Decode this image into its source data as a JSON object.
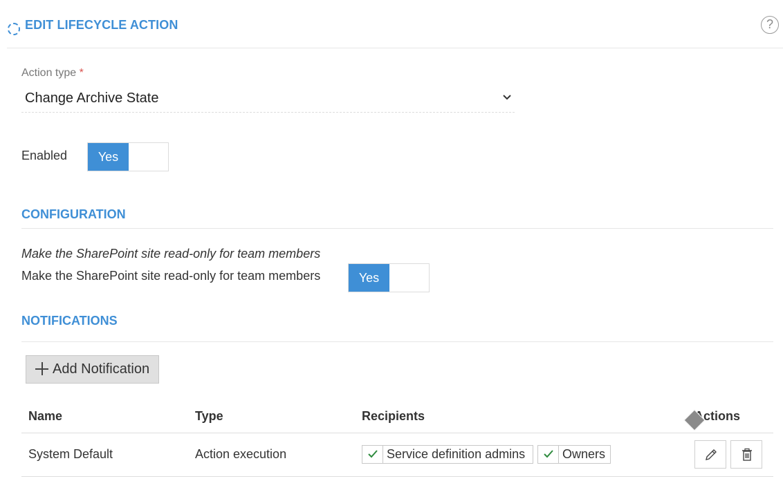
{
  "header": {
    "title": "EDIT LIFECYCLE ACTION",
    "help_glyph": "?"
  },
  "action_type": {
    "label": "Action type",
    "required_marker": "*",
    "selected_value": "Change Archive State"
  },
  "enabled": {
    "label": "Enabled",
    "toggle_value": "Yes"
  },
  "configuration": {
    "section_title": "CONFIGURATION",
    "description": "Make the SharePoint site read-only for team members",
    "field_label": "Make the SharePoint site read-only for team members",
    "toggle_value": "Yes"
  },
  "notifications": {
    "section_title": "NOTIFICATIONS",
    "add_button_label": "Add Notification",
    "columns": [
      "Name",
      "Type",
      "Recipients",
      "Actions"
    ],
    "rows": [
      {
        "name": "System Default",
        "type": "Action execution",
        "recipients": [
          "Service definition admins",
          "Owners"
        ]
      }
    ]
  },
  "colors": {
    "accent": "#3f8fd6",
    "check_green": "#2e8b3e"
  },
  "icons": [
    "loading-icon",
    "help-icon",
    "chevron-down-icon",
    "plus-icon",
    "check-icon",
    "edit-icon",
    "trash-icon"
  ]
}
